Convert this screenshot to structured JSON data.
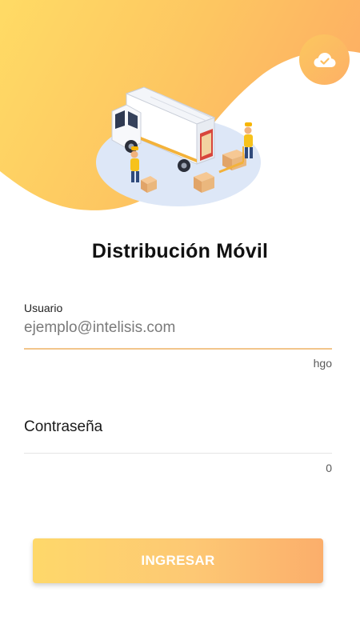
{
  "app": {
    "title": "Distribución Móvil"
  },
  "header": {
    "sync_icon": "cloud-check-icon",
    "illustration": "delivery-van-illustration"
  },
  "form": {
    "user": {
      "label": "Usuario",
      "placeholder": "ejemplo@intelisis.com",
      "value": "",
      "helper": "hgo"
    },
    "password": {
      "label": "",
      "placeholder": "Contraseña",
      "value": "",
      "helper": "0"
    },
    "submit_label": "INGRESAR"
  },
  "colors": {
    "accent_light": "#fed86a",
    "accent_dark": "#fdae66",
    "focus_underline": "#f2c58a"
  }
}
